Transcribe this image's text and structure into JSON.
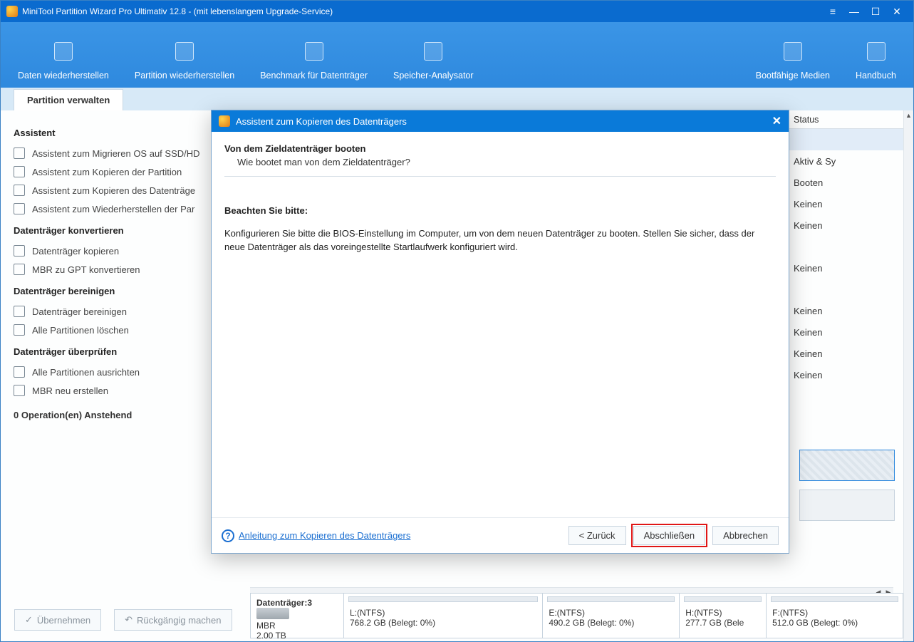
{
  "window": {
    "title": "MiniTool Partition Wizard Pro Ultimativ 12.8 - (mit lebenslangem Upgrade-Service)"
  },
  "ribbon": {
    "items": [
      "Daten wiederherstellen",
      "Partition wiederherstellen",
      "Benchmark für Datenträger",
      "Speicher-Analysator"
    ],
    "right_items": [
      "Bootfähige Medien",
      "Handbuch"
    ]
  },
  "tab": {
    "active": "Partition verwalten"
  },
  "sidebar": {
    "s1_title": "Assistent",
    "s1_items": [
      "Assistent zum Migrieren OS auf SSD/HD",
      "Assistent zum Kopieren der Partition",
      "Assistent zum Kopieren des Datenträge",
      "Assistent zum Wiederherstellen der Par"
    ],
    "s2_title": "Datenträger konvertieren",
    "s2_items": [
      "Datenträger kopieren",
      "MBR zu GPT konvertieren"
    ],
    "s3_title": "Datenträger bereinigen",
    "s3_items": [
      "Datenträger bereinigen",
      "Alle Partitionen löschen"
    ],
    "s4_title": "Datenträger überprüfen",
    "s4_items": [
      "Alle Partitionen ausrichten",
      "MBR neu erstellen"
    ],
    "pending": "0 Operation(en) Anstehend"
  },
  "table": {
    "status_header": "Status",
    "statuses": [
      "",
      "Aktiv & Sy",
      "Booten",
      "Keinen",
      "Keinen",
      "",
      "Keinen",
      "",
      "Keinen",
      "Keinen",
      "Keinen",
      "Keinen"
    ]
  },
  "disk3": {
    "label": "Datenträger:3",
    "scheme": "MBR",
    "size": "2.00 TB",
    "parts": [
      {
        "name": "L:(NTFS)",
        "info": "768.2 GB (Belegt: 0%)",
        "flex": 3
      },
      {
        "name": "E:(NTFS)",
        "info": "490.2 GB (Belegt: 0%)",
        "flex": 2
      },
      {
        "name": "H:(NTFS)",
        "info": "277.7 GB (Bele",
        "flex": 1.2
      },
      {
        "name": "F:(NTFS)",
        "info": "512.0 GB (Belegt: 0%)",
        "flex": 2
      }
    ]
  },
  "footer": {
    "apply": "Übernehmen",
    "undo": "Rückgängig machen"
  },
  "dialog": {
    "title": "Assistent zum Kopieren des Datenträgers",
    "heading": "Von dem Zieldatenträger booten",
    "sub": "Wie bootet man von dem Zieldatenträger?",
    "note_title": "Beachten Sie bitte:",
    "note_body": "Konfigurieren Sie bitte die BIOS-Einstellung im Computer, um von dem neuen Datenträger zu booten. Stellen Sie sicher, dass der neue Datenträger als das voreingestellte Startlaufwerk konfiguriert wird.",
    "help_link": "Anleitung zum Kopieren des Datenträgers",
    "back": "< Zurück",
    "finish": "Abschließen",
    "cancel": "Abbrechen"
  }
}
